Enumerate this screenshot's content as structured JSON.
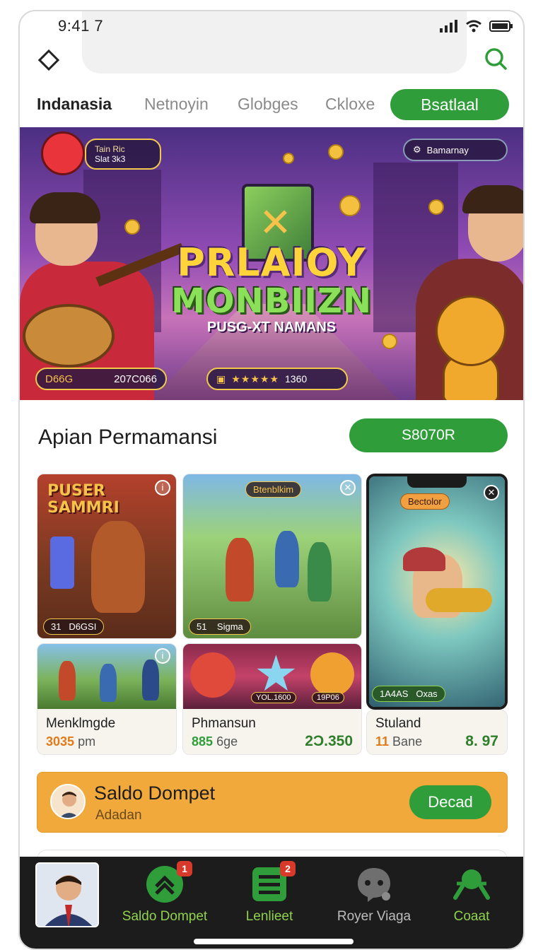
{
  "status_bar": {
    "time": "9:41 7"
  },
  "tabs": [
    {
      "label": "Indanasia",
      "active": true
    },
    {
      "label": "Netnoyin",
      "active": false
    },
    {
      "label": "Globges",
      "active": false
    },
    {
      "label": "Ckloxe",
      "active": false
    }
  ],
  "tab_cta": "Bsatlaal",
  "hero": {
    "title_line1": "PRLAIOY",
    "title_line2": "MONBIIZN",
    "subtitle": "PUSG-XT NAMANS",
    "profile_name": "Tain Ric",
    "profile_stat": "Slat 3k3",
    "top_right_label": "Bamarnay",
    "bottom_left_a": "D66G",
    "bottom_left_b": "207C066",
    "bottom_mid_stars": "★★★★★",
    "bottom_mid_value": "1360"
  },
  "section": {
    "title": "Apian Permamansi",
    "button": "S8070R"
  },
  "cards": [
    {
      "art_title": "PUSER\nSAMMRI",
      "badge_a": "31",
      "badge_b": "D6GSI"
    },
    {
      "art_title": "Btenblkim",
      "badge_a": "51",
      "badge_b": "Sigma"
    },
    {
      "art_title": "Bectolor",
      "badge_a": "1A4AS",
      "badge_b": "Oxas",
      "name": "Stuland",
      "sub_value": "11",
      "sub_unit": "Bane",
      "price": "8. 97"
    },
    {
      "name": "Menklmgde",
      "sub_value": "3035",
      "sub_unit": "pm"
    },
    {
      "badge_a": "YOL.1600",
      "badge_b": "19P06",
      "name": "Phmansun",
      "sub_value": "885",
      "sub_unit": "6ge",
      "price": "2Ɔ.350"
    }
  ],
  "wallet": {
    "title": "Saldo Dompet",
    "subtitle": "Adadan",
    "button": "Decad"
  },
  "bottom_nav": [
    {
      "label": "Saldo Dompet",
      "badge": "1",
      "icon": "chevrons-up-icon"
    },
    {
      "label": "Lenlieet",
      "badge": "2",
      "icon": "list-icon"
    },
    {
      "label": "Royer Viaga",
      "icon": "chat-bubble-icon"
    },
    {
      "label": "Coaat",
      "icon": "gamepad-icon"
    }
  ],
  "colors": {
    "accent_green": "#2f9e3a",
    "wallet_orange": "#f2a93b",
    "nav_bg": "#1c1c1c"
  }
}
